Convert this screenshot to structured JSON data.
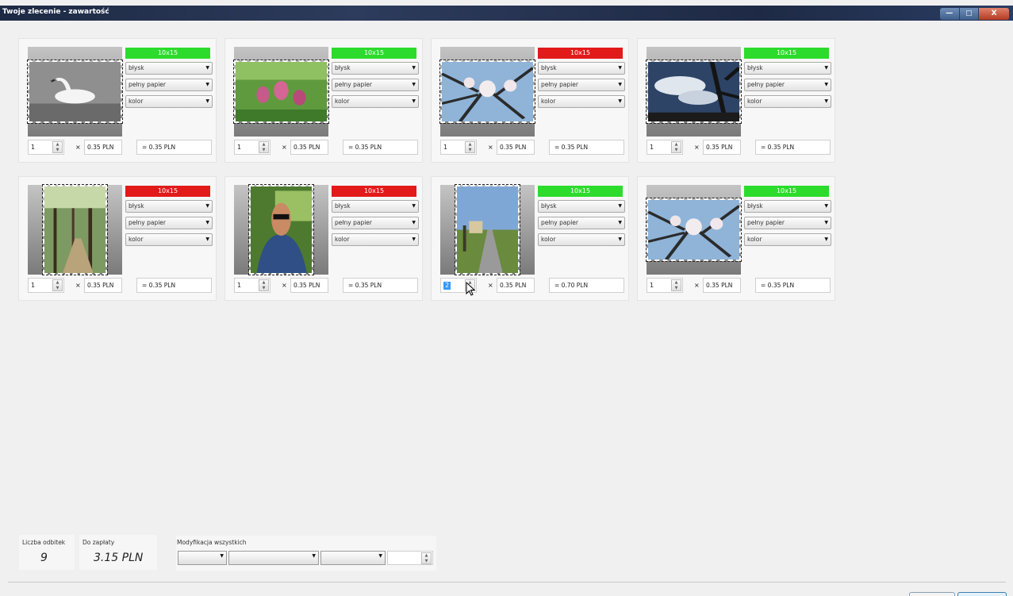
{
  "window": {
    "title": "Twoje zlecenie - zawartość",
    "controls": {
      "minimize": "—",
      "maximize": "▢",
      "close": "X"
    }
  },
  "colors": {
    "size_ok": "#2ddb2d",
    "size_bad": "#e21a1a"
  },
  "photos": [
    {
      "subject": "swan on water",
      "orientation": "landscape",
      "size": "10x15",
      "size_status": "ok",
      "finish": "błysk",
      "paper": "pełny papier",
      "color_mode": "kolor",
      "quantity": "1",
      "unit_price": "0.35 PLN",
      "total": "0.35 PLN"
    },
    {
      "subject": "pink flowers in grass",
      "orientation": "landscape",
      "size": "10x15",
      "size_status": "ok",
      "finish": "błysk",
      "paper": "pełny papier",
      "color_mode": "kolor",
      "quantity": "1",
      "unit_price": "0.35 PLN",
      "total": "0.35 PLN"
    },
    {
      "subject": "magnolia blossoms against sky",
      "orientation": "landscape",
      "size": "10x15",
      "size_status": "bad",
      "finish": "błysk",
      "paper": "pełny papier",
      "color_mode": "kolor",
      "quantity": "1",
      "unit_price": "0.35 PLN",
      "total": "0.35 PLN"
    },
    {
      "subject": "cloudy sky with tree",
      "orientation": "landscape",
      "size": "10x15",
      "size_status": "ok",
      "finish": "błysk",
      "paper": "pełny papier",
      "color_mode": "kolor",
      "quantity": "1",
      "unit_price": "0.35 PLN",
      "total": "0.35 PLN"
    },
    {
      "subject": "forest path",
      "orientation": "portrait",
      "size": "10x15",
      "size_status": "bad",
      "finish": "błysk",
      "paper": "pełny papier",
      "color_mode": "kolor",
      "quantity": "1",
      "unit_price": "0.35 PLN",
      "total": "0.35 PLN"
    },
    {
      "subject": "man with sunglasses",
      "orientation": "portrait",
      "size": "10x15",
      "size_status": "bad",
      "finish": "błysk",
      "paper": "pełny papier",
      "color_mode": "kolor",
      "quantity": "1",
      "unit_price": "0.35 PLN",
      "total": "0.35 PLN"
    },
    {
      "subject": "country road",
      "orientation": "portrait",
      "size": "10x15",
      "size_status": "ok",
      "finish": "błysk",
      "paper": "pełny papier",
      "color_mode": "kolor",
      "quantity": "2",
      "unit_price": "0.35 PLN",
      "total": "0.70 PLN",
      "focused": true
    },
    {
      "subject": "magnolia blossoms against sky",
      "orientation": "landscape",
      "size": "10x15",
      "size_status": "ok",
      "finish": "błysk",
      "paper": "pełny papier",
      "color_mode": "kolor",
      "quantity": "1",
      "unit_price": "0.35 PLN",
      "total": "0.35 PLN"
    }
  ],
  "summary": {
    "count_label": "Liczba odbitek",
    "count_value": "9",
    "pay_label": "Do zapłaty",
    "pay_value": "3.15 PLN",
    "modify_label": "Modyfikacja wszystkich"
  },
  "icons": {
    "spin": "spin-updown-icon",
    "dropdown": "chevron-down-icon",
    "cursor": "mouse-pointer-icon"
  }
}
